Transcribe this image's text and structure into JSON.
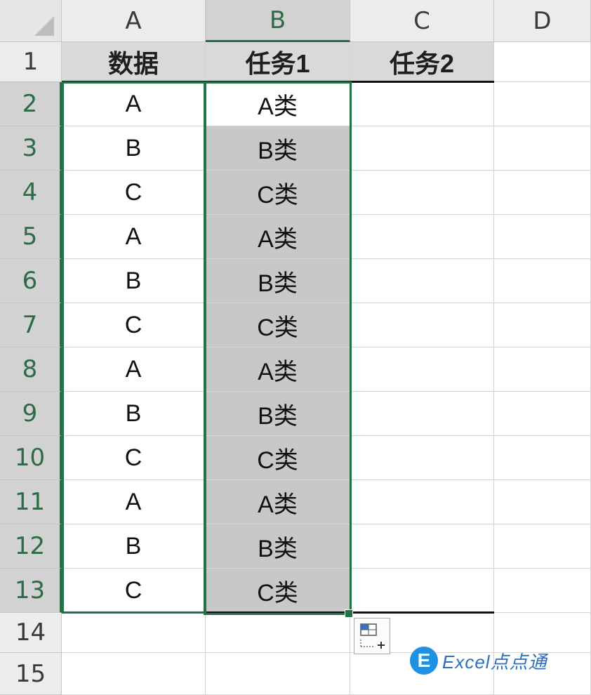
{
  "columns": [
    "A",
    "B",
    "C",
    "D"
  ],
  "rows": [
    "1",
    "2",
    "3",
    "4",
    "5",
    "6",
    "7",
    "8",
    "9",
    "10",
    "11",
    "12",
    "13",
    "14",
    "15"
  ],
  "header_row": {
    "a": "数据",
    "b": "任务1",
    "c": "任务2"
  },
  "data_rows": [
    {
      "a": "A",
      "b": "A类"
    },
    {
      "a": "B",
      "b": "B类"
    },
    {
      "a": "C",
      "b": "C类"
    },
    {
      "a": "A",
      "b": "A类"
    },
    {
      "a": "B",
      "b": "B类"
    },
    {
      "a": "C",
      "b": "C类"
    },
    {
      "a": "A",
      "b": "A类"
    },
    {
      "a": "B",
      "b": "B类"
    },
    {
      "a": "C",
      "b": "C类"
    },
    {
      "a": "A",
      "b": "A类"
    },
    {
      "a": "B",
      "b": "B类"
    },
    {
      "a": "C",
      "b": "C类"
    }
  ],
  "selection": {
    "column": "B",
    "rows": "2-13"
  },
  "watermark": {
    "logo_letter": "E",
    "text": "Excel点点通"
  },
  "colors": {
    "accent": "#217346",
    "selection_fill": "#c8c8c8",
    "header_fill": "#d9d9d9",
    "logo": "#1e90e6"
  }
}
